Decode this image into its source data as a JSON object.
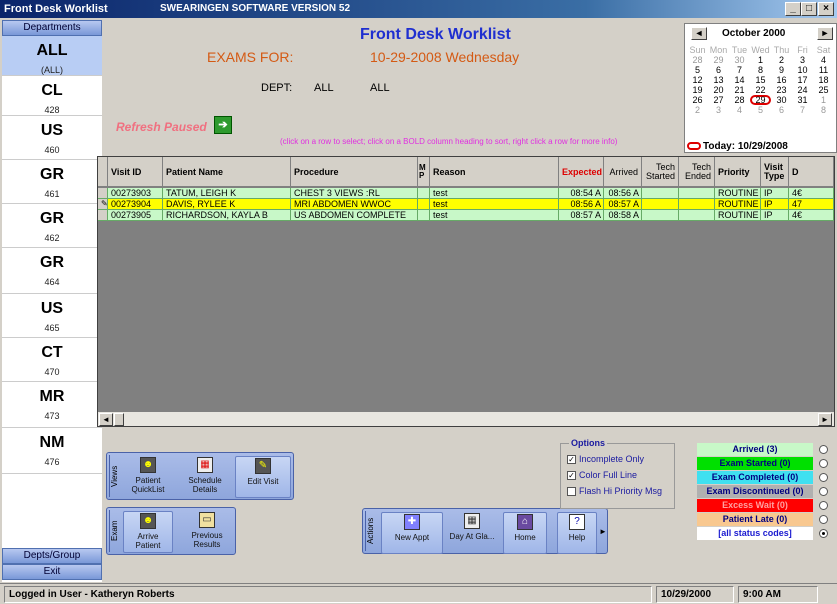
{
  "window": {
    "title": "Front Desk Worklist",
    "version": "SWEARINGEN SOFTWARE VERSION 52",
    "min": "_",
    "max": "□",
    "close": "×"
  },
  "sidebar": {
    "header": "Departments",
    "items": [
      {
        "code": "ALL",
        "sub": "(ALL)"
      },
      {
        "code": "CL",
        "sub": "428"
      },
      {
        "code": "US",
        "sub": "460"
      },
      {
        "code": "GR",
        "sub": "461"
      },
      {
        "code": "GR",
        "sub": "462"
      },
      {
        "code": "GR",
        "sub": "464"
      },
      {
        "code": "US",
        "sub": "465"
      },
      {
        "code": "CT",
        "sub": "470"
      },
      {
        "code": "MR",
        "sub": "473"
      },
      {
        "code": "NM",
        "sub": "476"
      }
    ],
    "depts_group": "Depts/Group",
    "exit": "Exit"
  },
  "header": {
    "title": "Front Desk Worklist",
    "exams_for_label": "EXAMS FOR:",
    "date": "10-29-2008 Wednesday",
    "dept_label": "DEPT:",
    "dept_value": "ALL",
    "dept_value2": "ALL",
    "refresh": "Refresh Paused",
    "hint": "(click on a row to select; click on a BOLD column heading to sort, right click a row for more info)"
  },
  "calendar": {
    "month": "October 2000",
    "prev": "◄",
    "next": "►",
    "dow": [
      "Sun",
      "Mon",
      "Tue",
      "Wed",
      "Thu",
      "Fri",
      "Sat"
    ],
    "weeks": [
      [
        "28",
        "29",
        "30",
        "1",
        "2",
        "3",
        "4"
      ],
      [
        "5",
        "6",
        "7",
        "8",
        "9",
        "10",
        "11"
      ],
      [
        "12",
        "13",
        "14",
        "15",
        "16",
        "17",
        "18"
      ],
      [
        "19",
        "20",
        "21",
        "22",
        "23",
        "24",
        "25"
      ],
      [
        "26",
        "27",
        "28",
        "29",
        "30",
        "31",
        "1"
      ],
      [
        "2",
        "3",
        "4",
        "5",
        "6",
        "7",
        "8"
      ]
    ],
    "today_label": "Today: 10/29/2008"
  },
  "grid": {
    "columns": [
      "Visit ID",
      "Patient Name",
      "Procedure",
      "M P",
      "Reason",
      "Expected",
      "Arrived",
      "Tech Started",
      "Tech Ended",
      "Priority",
      "Visit Type",
      "D"
    ],
    "rows": [
      {
        "visit_id": "00273903",
        "name": "TATUM, LEIGH K",
        "procedure": "CHEST 3 VIEWS :RL",
        "mp": "",
        "reason": "test",
        "expected": "08:54 A",
        "arrived": "08:56 A",
        "tech_started": "",
        "tech_ended": "",
        "priority": "ROUTINE",
        "visit_type": "IP",
        "d": "4€",
        "color": "#c8f8c8"
      },
      {
        "visit_id": "00273904",
        "name": "DAVIS, RYLEE K",
        "procedure": "MRI ABDOMEN WWOC",
        "mp": "",
        "reason": "test",
        "expected": "08:56 A",
        "arrived": "08:57 A",
        "tech_started": "",
        "tech_ended": "",
        "priority": "ROUTINE",
        "visit_type": "IP",
        "d": "47",
        "color": "#ffff00"
      },
      {
        "visit_id": "00273905",
        "name": "RICHARDSON, KAYLA B",
        "procedure": "US ABDOMEN COMPLETE",
        "mp": "",
        "reason": "test",
        "expected": "08:57 A",
        "arrived": "08:58 A",
        "tech_started": "",
        "tech_ended": "",
        "priority": "ROUTINE",
        "visit_type": "IP",
        "d": "4€",
        "color": "#c8f8c8"
      }
    ]
  },
  "toolbars": {
    "views": {
      "label": "Views",
      "buttons": [
        "Patient QuickList",
        "Schedule Details",
        "Edit Visit"
      ]
    },
    "exam": {
      "label": "Exam",
      "buttons": [
        "Arrive Patient",
        "Previous Results"
      ]
    },
    "actions": {
      "label": "Actions",
      "buttons": [
        "New Appt",
        "Day At Gla...",
        "Home",
        "Help"
      ]
    }
  },
  "options": {
    "title": "Options",
    "items": [
      {
        "label": "Incomplete Only",
        "checked": "✓"
      },
      {
        "label": "Color Full Line",
        "checked": "✓"
      },
      {
        "label": "Flash Hi Priority Msg",
        "checked": ""
      }
    ]
  },
  "status_codes": [
    {
      "label": "Arrived (3)",
      "bg": "#c8f8c8",
      "fg": "#000080"
    },
    {
      "label": "Exam Started (0)",
      "bg": "#00e000",
      "fg": "#000080"
    },
    {
      "label": "Exam Completed (0)",
      "bg": "#40e0f0",
      "fg": "#000080"
    },
    {
      "label": "Exam Discontinued (0)",
      "bg": "#b0b0b0",
      "fg": "#000080"
    },
    {
      "label": "Excess Wait (0)",
      "bg": "#ff0000",
      "fg": "#ffa0a0"
    },
    {
      "label": "Patient Late (0)",
      "bg": "#f8c890",
      "fg": "#000080"
    },
    {
      "label": "[all status codes]",
      "bg": "#ffffff",
      "fg": "#1a1ad0"
    }
  ],
  "statusbar": {
    "user": "Logged in User - Katheryn Roberts",
    "date": "10/29/2000",
    "time": "9:00 AM"
  }
}
